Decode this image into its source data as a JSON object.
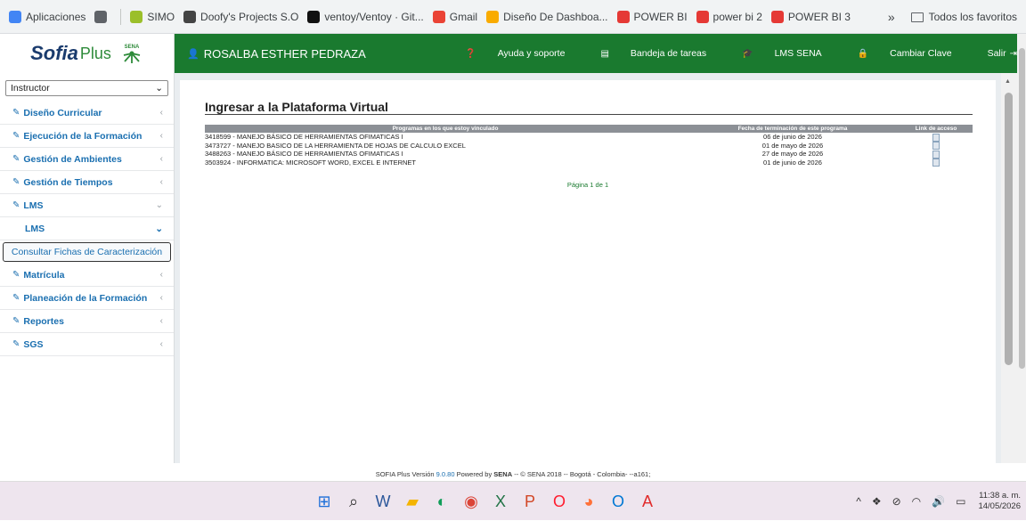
{
  "bookmarks": [
    {
      "label": "Aplicaciones",
      "color": "#4285f4"
    },
    {
      "label": "",
      "color": "#5f6368"
    },
    {
      "label": "SIMO",
      "color": "#9bbf2a"
    },
    {
      "label": "Doofy's Projects S.O",
      "color": "#444444"
    },
    {
      "label": "ventoy/Ventoy · Git...",
      "color": "#111111"
    },
    {
      "label": "Gmail",
      "color": "#ea4335"
    },
    {
      "label": "Diseño De Dashboa...",
      "color": "#f9ab00"
    },
    {
      "label": "POWER BI",
      "color": "#e53935"
    },
    {
      "label": "power bi 2",
      "color": "#e53935"
    },
    {
      "label": "POWER BI 3",
      "color": "#e53935"
    }
  ],
  "bookmarks_right": {
    "more": "»",
    "folder_label": "Todos los favoritos"
  },
  "header": {
    "logo": "Sofia",
    "logo_plus": "Plus",
    "sena": "SENA",
    "user": "ROSALBA ESTHER PEDRAZA",
    "nav": [
      {
        "label": "Ayuda y soporte",
        "icon": "help-icon",
        "glyph": "❓"
      },
      {
        "label": "Bandeja de tareas",
        "icon": "tray-icon",
        "glyph": "▤"
      },
      {
        "label": "LMS SENA",
        "icon": "graduation-icon",
        "glyph": "🎓"
      },
      {
        "label": "Cambiar Clave",
        "icon": "lock-icon",
        "glyph": "🔒"
      },
      {
        "label": "Salir",
        "icon": "logout-icon",
        "glyph": "⇥"
      }
    ]
  },
  "sidebar": {
    "role": "Instructor",
    "items": [
      {
        "label": "Diseño Curricular",
        "caret": "‹"
      },
      {
        "label": "Ejecución de la Formación",
        "caret": "‹"
      },
      {
        "label": "Gestión de Ambientes",
        "caret": "‹"
      },
      {
        "label": "Gestión de Tiempos",
        "caret": "‹"
      },
      {
        "label": "LMS",
        "caret": "⌄"
      }
    ],
    "sub": {
      "label": "LMS",
      "caret": "⌄"
    },
    "subsub": "Consultar Fichas de Caracterización",
    "items2": [
      {
        "label": "Matrícula",
        "caret": "‹"
      },
      {
        "label": "Planeación de la Formación",
        "caret": "‹"
      },
      {
        "label": "Reportes",
        "caret": "‹"
      },
      {
        "label": "SGS",
        "caret": "‹"
      }
    ]
  },
  "main": {
    "title": "Ingresar a la Plataforma Virtual",
    "columns": [
      "Programas en los que estoy vinculado",
      "Fecha de terminación de este programa",
      "Link de acceso"
    ],
    "rows": [
      {
        "program": "3418599 - MANEJO BÁSICO DE HERRAMIENTAS OFIMATICAS I",
        "date": "06 de junio de 2026"
      },
      {
        "program": "3473727 - MANEJO BASICO DE LA HERRAMIENTA DE HOJAS DE CALCULO EXCEL",
        "date": "01 de mayo de 2026"
      },
      {
        "program": "3488263 - MANEJO BÁSICO DE HERRAMIENTAS OFIMATICAS I",
        "date": "27 de mayo de 2026"
      },
      {
        "program": "3503924 - INFORMATICA: MICROSOFT WORD, EXCEL E INTERNET",
        "date": "01 de junio de 2026"
      }
    ],
    "pager": "Página 1 de 1"
  },
  "footer": {
    "prefix": "SOFIA Plus Versión ",
    "version": "9.0.80",
    "mid": " Powered by ",
    "sena": "SENA",
    "rest": " -- © SENA 2018 -- Bogotá - Colombia- --a161;"
  },
  "taskbar": {
    "icons": [
      {
        "name": "windows-start-icon",
        "glyph": "⊞",
        "color": "#1e6fd9"
      },
      {
        "name": "search-icon",
        "glyph": "⌕",
        "color": "#333333"
      },
      {
        "name": "word-icon",
        "glyph": "W",
        "color": "#2b579a"
      },
      {
        "name": "file-explorer-icon",
        "glyph": "▰",
        "color": "#f4b400"
      },
      {
        "name": "edge-icon",
        "glyph": "◐",
        "color": "#0f9d58"
      },
      {
        "name": "chrome-icon",
        "glyph": "◉",
        "color": "#db4437"
      },
      {
        "name": "excel-icon",
        "glyph": "X",
        "color": "#217346"
      },
      {
        "name": "powerpoint-icon",
        "glyph": "P",
        "color": "#d24726"
      },
      {
        "name": "opera-icon",
        "glyph": "O",
        "color": "#ff1b2d"
      },
      {
        "name": "firefox-icon",
        "glyph": "◕",
        "color": "#ff7139"
      },
      {
        "name": "outlook-icon",
        "glyph": "O",
        "color": "#0078d4"
      },
      {
        "name": "acrobat-icon",
        "glyph": "A",
        "color": "#e12b2b"
      }
    ],
    "time": "11:38 a. m.",
    "date": "14/05/2026"
  }
}
